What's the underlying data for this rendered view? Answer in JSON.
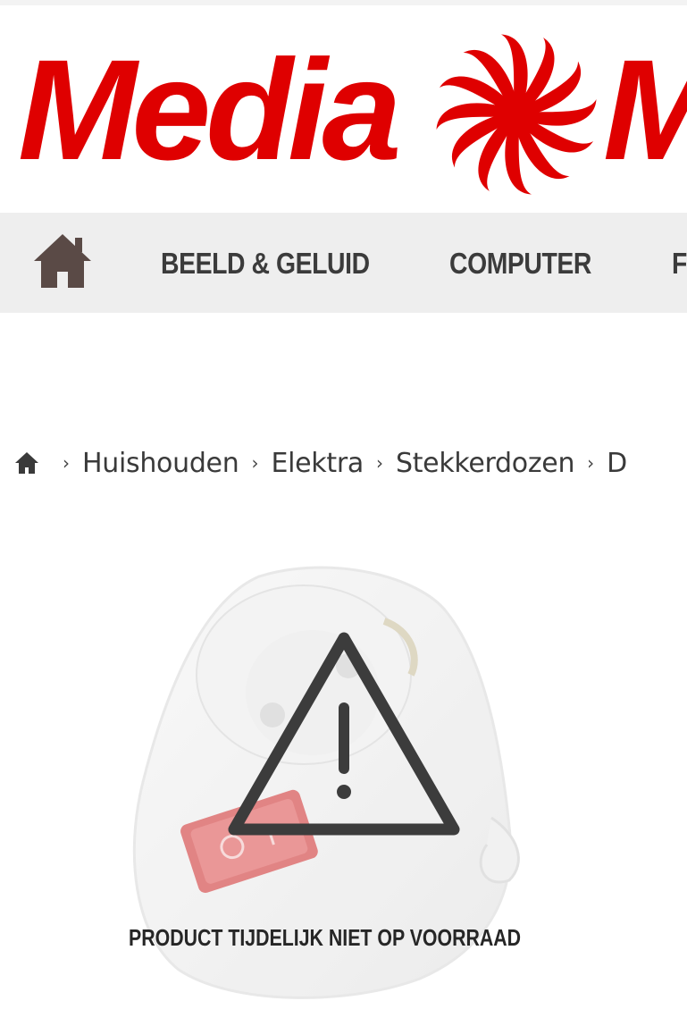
{
  "brand": {
    "logo_text": "MediaMarkt",
    "color": "#df0000"
  },
  "nav": {
    "home_icon": "home-icon",
    "items": [
      {
        "label": "BEELD & GELUID"
      },
      {
        "label": "COMPUTER"
      },
      {
        "label": "F"
      }
    ]
  },
  "breadcrumb": {
    "home_icon": "home-icon",
    "separator": "›",
    "items": [
      {
        "label": "Huishouden"
      },
      {
        "label": "Elektra"
      },
      {
        "label": "Stekkerdozen"
      },
      {
        "label": "D"
      }
    ]
  },
  "product": {
    "image_icon": "plug-adapter-image",
    "warning_icon": "warning-triangle-icon",
    "stock_message": "PRODUCT TIJDELIJK NIET OP VOORRAAD"
  }
}
